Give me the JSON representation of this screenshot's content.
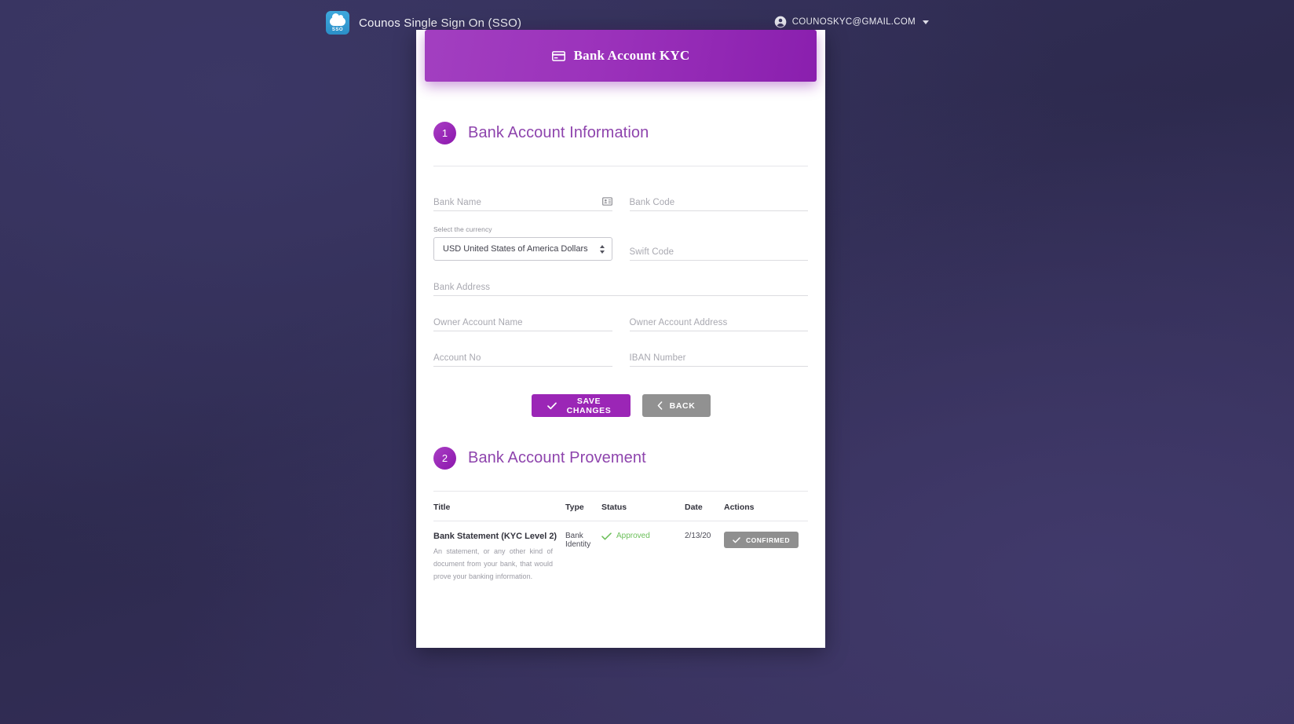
{
  "header": {
    "brand_title": "Counos Single Sign On (SSO)",
    "logo_text": "SSO",
    "user_email": "COUNOSKYC@GMAIL.COM"
  },
  "modal": {
    "title": "Bank Account KYC",
    "icon": "credit-card-icon"
  },
  "section1": {
    "number": "1",
    "title": "Bank Account Information",
    "fields": {
      "bank_name": {
        "placeholder": "Bank Name",
        "value": "",
        "icon": "contact-card-icon"
      },
      "bank_code": {
        "placeholder": "Bank Code",
        "value": ""
      },
      "currency": {
        "label": "Select the currency",
        "selected": "USD United States of America Dollars"
      },
      "swift_code": {
        "placeholder": "Swift Code",
        "value": ""
      },
      "bank_address": {
        "placeholder": "Bank Address",
        "value": ""
      },
      "owner_account_name": {
        "placeholder": "Owner Account Name",
        "value": ""
      },
      "owner_account_address": {
        "placeholder": "Owner Account Address",
        "value": ""
      },
      "account_no": {
        "placeholder": "Account No",
        "value": ""
      },
      "iban_number": {
        "placeholder": "IBAN Number",
        "value": ""
      }
    },
    "buttons": {
      "save": "SAVE CHANGES",
      "back": "BACK"
    }
  },
  "section2": {
    "number": "2",
    "title": "Bank Account Provement",
    "table": {
      "columns": [
        "Title",
        "Type",
        "Status",
        "Date",
        "Actions"
      ],
      "rows": [
        {
          "title": "Bank Statement (KYC Level 2)",
          "description": "An statement, or any other kind of document from your bank, that would prove your banking information.",
          "type": "Bank Identity",
          "status": "Approved",
          "date": "2/13/20",
          "action": "CONFIRMED"
        }
      ]
    }
  },
  "colors": {
    "accent_purple": "#9b26b6",
    "heading_purple": "#8e44ad",
    "status_green": "#6bbf59",
    "action_gray": "#8f8f8f",
    "page_background": "#2f2c52"
  }
}
